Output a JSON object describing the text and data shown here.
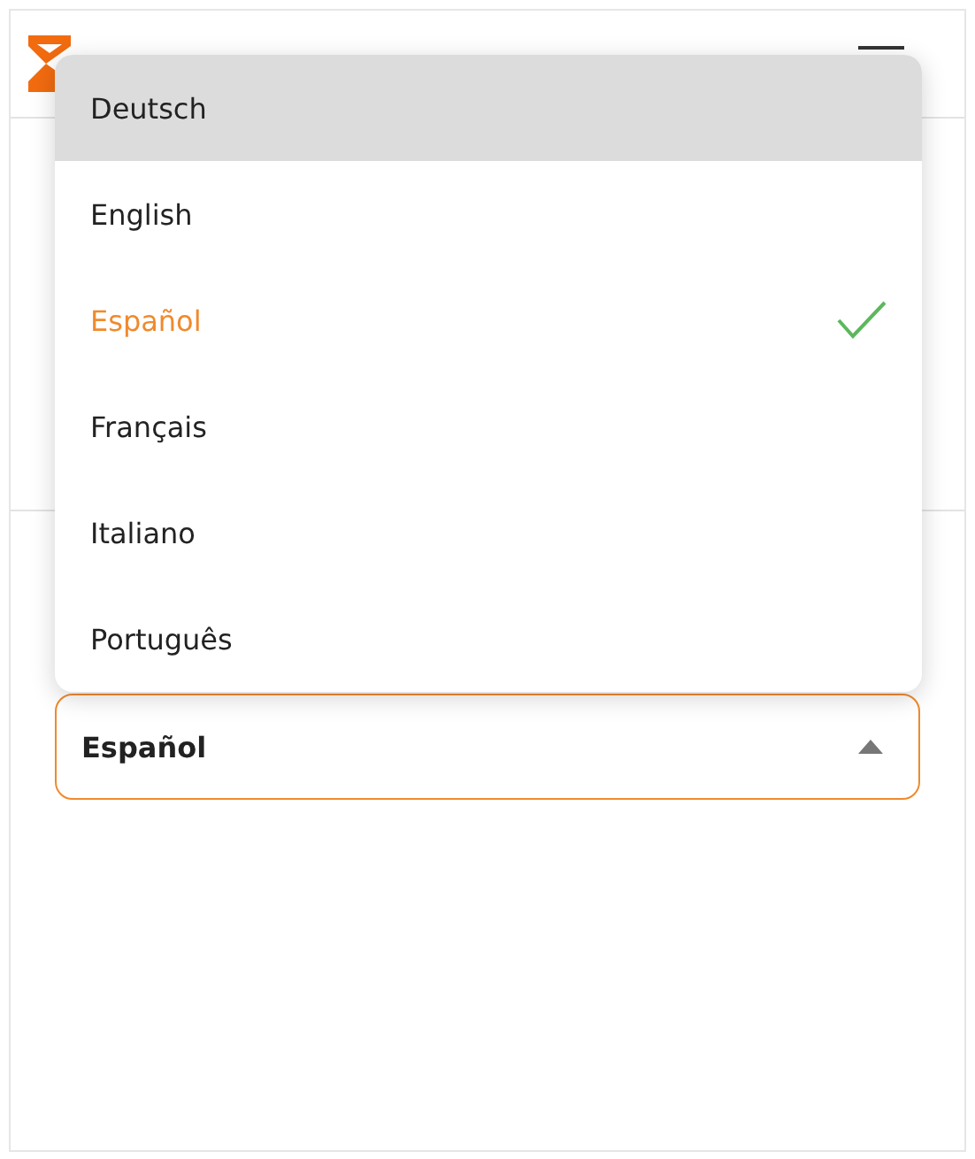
{
  "language_menu": [
    {
      "label": "Deutsch",
      "selected": false,
      "highlighted": true
    },
    {
      "label": "English",
      "selected": false,
      "highlighted": false
    },
    {
      "label": "Español",
      "selected": true,
      "highlighted": false
    },
    {
      "label": "Français",
      "selected": false,
      "highlighted": false
    },
    {
      "label": "Italiano",
      "selected": false,
      "highlighted": false
    },
    {
      "label": "Português",
      "selected": false,
      "highlighted": false
    }
  ],
  "language_select": {
    "value": "Español",
    "expanded": true
  }
}
